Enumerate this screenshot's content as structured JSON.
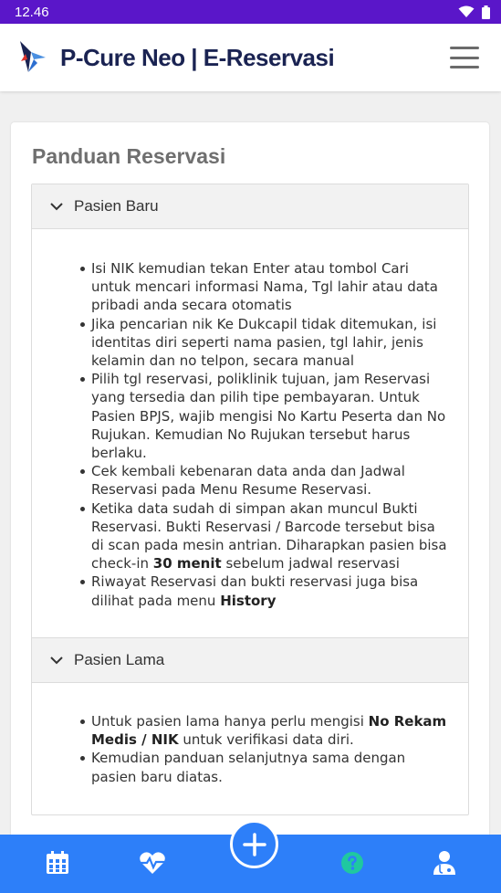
{
  "status": {
    "time": "12.46"
  },
  "app": {
    "title": "P-Cure Neo | E-Reservasi"
  },
  "card": {
    "title": "Panduan Reservasi"
  },
  "sections": [
    {
      "title": "Pasien Baru",
      "items": [
        "Isi NIK kemudian tekan Enter atau tombol Cari untuk mencari informasi Nama, Tgl lahir atau data pribadi anda secara otomatis",
        "Jika pencarian nik Ke Dukcapil tidak ditemukan, isi identitas diri seperti nama pasien, tgl lahir, jenis kelamin dan no telpon, secara manual",
        "Pilih tgl reservasi, poliklinik tujuan, jam Reservasi yang tersedia dan pilih tipe pembayaran. Untuk Pasien BPJS, wajib mengisi No Kartu Peserta dan No Rujukan. Kemudian No Rujukan tersebut harus berlaku.",
        "Cek kembali kebenaran data anda dan Jadwal Reservasi pada Menu Resume Reservasi.",
        {
          "pre": "Ketika data sudah di simpan akan muncul Bukti Reservasi. Bukti Reservasi / Barcode tersebut bisa di scan pada mesin antrian. Diharapkan pasien bisa check-in ",
          "bold": "30 menit",
          "post": " sebelum jadwal reservasi"
        },
        {
          "pre": "Riwayat Reservasi dan bukti reservasi juga bisa dilihat pada menu ",
          "bold": "History",
          "post": ""
        }
      ]
    },
    {
      "title": "Pasien Lama",
      "items": [
        {
          "pre": "Untuk pasien lama hanya perlu mengisi ",
          "bold": "No Rekam Medis / NIK",
          "post": " untuk verifikasi data diri."
        },
        "Kemudian panduan selanjutnya sama dengan pasien baru diatas."
      ]
    }
  ],
  "nav": {
    "items": [
      {
        "icon": "calendar-icon"
      },
      {
        "icon": "heartbeat-icon"
      },
      {
        "icon": "plus-circle-icon"
      },
      {
        "icon": "question-circle-icon",
        "active": true
      },
      {
        "icon": "doctor-icon"
      }
    ],
    "active_color": "#1fc8a0",
    "bar_color": "#2d7ff9"
  },
  "colors": {
    "status_bar": "#5a16c9",
    "title": "#1a2352"
  }
}
